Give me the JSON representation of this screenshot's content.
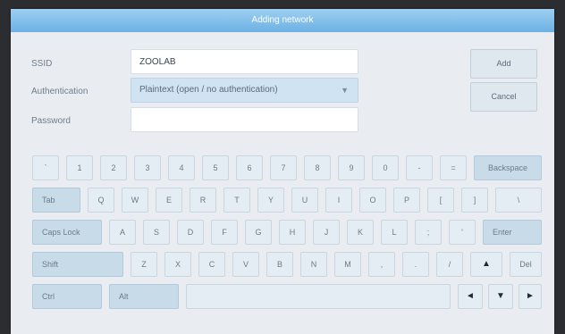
{
  "dialog": {
    "title": "Adding network"
  },
  "form": {
    "ssid_label": "SSID",
    "ssid_value": "ZOOLAB",
    "auth_label": "Authentication",
    "auth_value": "Plaintext (open / no authentication)",
    "password_label": "Password",
    "password_value": ""
  },
  "buttons": {
    "add": "Add",
    "cancel": "Cancel"
  },
  "icons": {
    "dropdown": "chevron-down-icon"
  },
  "keyboard": {
    "row1": [
      "`",
      "1",
      "2",
      "3",
      "4",
      "5",
      "6",
      "7",
      "8",
      "9",
      "0",
      "-",
      "=",
      "Backspace"
    ],
    "row2": [
      "Tab",
      "Q",
      "W",
      "E",
      "R",
      "T",
      "Y",
      "U",
      "I",
      "O",
      "P",
      "[",
      "]",
      "\\"
    ],
    "row3": [
      "Caps Lock",
      "A",
      "S",
      "D",
      "F",
      "G",
      "H",
      "J",
      "K",
      "L",
      ";",
      "'",
      "Enter"
    ],
    "row4": [
      "Shift",
      "Z",
      "X",
      "C",
      "V",
      "B",
      "N",
      "M",
      ",",
      ".",
      "/",
      "▲",
      "Del"
    ],
    "row5": [
      "Ctrl",
      "Alt",
      "",
      "◄",
      "▼",
      "►"
    ]
  },
  "colors": {
    "title_bar": "#7bbbe8",
    "key_face": "#e4edf3",
    "modifier_key_face": "#c8dbe9",
    "background": "#2b2d30"
  }
}
